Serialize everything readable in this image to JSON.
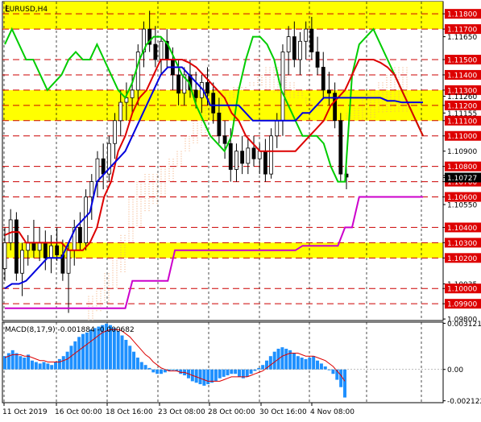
{
  "chart_data": [
    {
      "type": "candlestick",
      "title": "EURUSD,H4",
      "y_range": [
        1.0979,
        1.1188
      ],
      "y_ticks": [
        {
          "v": 1.118,
          "t": "1.11800",
          "style": "box-red"
        },
        {
          "v": 1.117,
          "t": "1.11700",
          "style": "box-red"
        },
        {
          "v": 1.1165,
          "t": "1.11650",
          "style": "plain"
        },
        {
          "v": 1.115,
          "t": "1.11500",
          "style": "box-red"
        },
        {
          "v": 1.114,
          "t": "1.11400",
          "style": "box-red"
        },
        {
          "v": 1.113,
          "t": "1.11300",
          "style": "box-red"
        },
        {
          "v": 1.1126,
          "t": "1.11260",
          "style": "plain"
        },
        {
          "v": 1.112,
          "t": "1.11200",
          "style": "box-red"
        },
        {
          "v": 1.1115,
          "t": "1.11155",
          "style": "plain"
        },
        {
          "v": 1.111,
          "t": "1.11100",
          "style": "box-red"
        },
        {
          "v": 1.11,
          "t": "1.11000",
          "style": "box-red"
        },
        {
          "v": 1.109,
          "t": "1.10900",
          "style": "plain"
        },
        {
          "v": 1.108,
          "t": "1.10800",
          "style": "box-red"
        },
        {
          "v": 1.1074,
          "t": "1.10745",
          "style": "plain"
        },
        {
          "v": 1.107,
          "t": "1.10700",
          "style": "box-red"
        },
        {
          "v": 1.106,
          "t": "1.10600",
          "style": "box-red"
        },
        {
          "v": 1.1055,
          "t": "1.10550",
          "style": "plain"
        },
        {
          "v": 1.104,
          "t": "1.10400",
          "style": "box-red"
        },
        {
          "v": 1.103,
          "t": "1.10300",
          "style": "box-red"
        },
        {
          "v": 1.102,
          "t": "1.10200",
          "style": "box-red"
        },
        {
          "v": 1.1003,
          "t": "1.10035",
          "style": "plain"
        },
        {
          "v": 1.1,
          "t": "1.10000",
          "style": "box-red"
        },
        {
          "v": 1.099,
          "t": "1.09900",
          "style": "box-red"
        },
        {
          "v": 1.098,
          "t": "1.09800",
          "style": "plain"
        },
        {
          "v": 1.10727,
          "t": "1.10727",
          "style": "box-dark"
        }
      ],
      "red_levels": [
        1.118,
        1.117,
        1.115,
        1.114,
        1.113,
        1.112,
        1.111,
        1.11,
        1.108,
        1.107,
        1.106,
        1.104,
        1.103,
        1.102,
        1.1,
        1.099
      ],
      "yellow_bands": [
        [
          1.117,
          1.1188
        ],
        [
          1.111,
          1.113
        ],
        [
          1.102,
          1.103
        ]
      ],
      "x_labels": [
        "11 Oct 2019",
        "16 Oct 00:00",
        "18 Oct 16:00",
        "23 Oct 08:00",
        "28 Oct 00:00",
        "30 Oct 16:00",
        "4 Nov 08:00"
      ],
      "candles": [
        [
          1.1013,
          1.104,
          1.1005,
          1.103
        ],
        [
          1.103,
          1.1052,
          1.1025,
          1.1045
        ],
        [
          1.1045,
          1.105,
          1.1005,
          1.101
        ],
        [
          1.101,
          1.103,
          1.0995,
          1.1025
        ],
        [
          1.1025,
          1.1035,
          1.1015,
          1.103
        ],
        [
          1.103,
          1.1045,
          1.102,
          1.1025
        ],
        [
          1.1025,
          1.104,
          1.1018,
          1.103
        ],
        [
          1.103,
          1.1038,
          1.1012,
          1.102
        ],
        [
          1.102,
          1.1035,
          1.101,
          1.1028
        ],
        [
          1.1028,
          1.104,
          1.1018,
          1.1022
        ],
        [
          1.1022,
          1.1032,
          1.1005,
          1.101
        ],
        [
          1.101,
          1.103,
          1.0984,
          1.1025
        ],
        [
          1.1025,
          1.1045,
          1.1015,
          1.104
        ],
        [
          1.104,
          1.105,
          1.1025,
          1.103
        ],
        [
          1.103,
          1.1065,
          1.1025,
          1.106
        ],
        [
          1.106,
          1.1075,
          1.1045,
          1.107
        ],
        [
          1.107,
          1.109,
          1.106,
          1.1085
        ],
        [
          1.1085,
          1.1095,
          1.1065,
          1.1075
        ],
        [
          1.1075,
          1.11,
          1.107,
          1.1095
        ],
        [
          1.1095,
          1.1115,
          1.1085,
          1.111
        ],
        [
          1.111,
          1.113,
          1.11,
          1.1122
        ],
        [
          1.1122,
          1.1135,
          1.111,
          1.1125
        ],
        [
          1.1125,
          1.114,
          1.1115,
          1.113
        ],
        [
          1.113,
          1.116,
          1.112,
          1.1155
        ],
        [
          1.1155,
          1.1175,
          1.1145,
          1.117
        ],
        [
          1.117,
          1.1182,
          1.1155,
          1.116
        ],
        [
          1.116,
          1.1172,
          1.1145,
          1.115
        ],
        [
          1.115,
          1.1165,
          1.114,
          1.1162
        ],
        [
          1.1162,
          1.117,
          1.1145,
          1.115
        ],
        [
          1.115,
          1.1158,
          1.113,
          1.114
        ],
        [
          1.114,
          1.115,
          1.112,
          1.1128
        ],
        [
          1.1128,
          1.1145,
          1.112,
          1.114
        ],
        [
          1.114,
          1.115,
          1.1125,
          1.113
        ],
        [
          1.113,
          1.1142,
          1.1118,
          1.1125
        ],
        [
          1.1125,
          1.114,
          1.1115,
          1.1135
        ],
        [
          1.1135,
          1.1145,
          1.112,
          1.1128
        ],
        [
          1.1128,
          1.1135,
          1.1108,
          1.1115
        ],
        [
          1.1115,
          1.1125,
          1.1095,
          1.11
        ],
        [
          1.11,
          1.111,
          1.1085,
          1.1095
        ],
        [
          1.1095,
          1.1105,
          1.107,
          1.1078
        ],
        [
          1.1078,
          1.1095,
          1.107,
          1.109
        ],
        [
          1.109,
          1.11,
          1.1075,
          1.1082
        ],
        [
          1.1082,
          1.1098,
          1.1075,
          1.1092
        ],
        [
          1.1092,
          1.11,
          1.108,
          1.1085
        ],
        [
          1.1085,
          1.1095,
          1.1075,
          1.109
        ],
        [
          1.109,
          1.1098,
          1.107,
          1.1075
        ],
        [
          1.1075,
          1.1105,
          1.1072,
          1.11
        ],
        [
          1.11,
          1.1115,
          1.1092,
          1.111
        ],
        [
          1.111,
          1.116,
          1.11,
          1.1155
        ],
        [
          1.1155,
          1.1172,
          1.114,
          1.1165
        ],
        [
          1.1165,
          1.1175,
          1.1145,
          1.115
        ],
        [
          1.115,
          1.1168,
          1.114,
          1.1162
        ],
        [
          1.1162,
          1.1175,
          1.115,
          1.117
        ],
        [
          1.117,
          1.1178,
          1.115,
          1.1155
        ],
        [
          1.1155,
          1.1165,
          1.114,
          1.1145
        ],
        [
          1.1145,
          1.1155,
          1.1125,
          1.113
        ],
        [
          1.113,
          1.1142,
          1.112,
          1.1128
        ],
        [
          1.1128,
          1.1135,
          1.1105,
          1.111
        ],
        [
          1.111,
          1.1115,
          1.107,
          1.1075
        ],
        [
          1.1075,
          1.1085,
          1.1065,
          1.1073
        ]
      ],
      "lines": [
        {
          "color": "#00cc00",
          "width": 2,
          "values": [
            1.116,
            1.117,
            1.116,
            1.115,
            1.115,
            1.114,
            1.113,
            1.1135,
            1.114,
            1.115,
            1.1155,
            1.115,
            1.115,
            1.116,
            1.115,
            1.114,
            1.113,
            1.1125,
            1.1135,
            1.115,
            1.116,
            1.1165,
            1.1165,
            1.116,
            1.115,
            1.114,
            1.1135,
            1.112,
            1.111,
            1.11,
            1.1095,
            1.109,
            1.11,
            1.113,
            1.115,
            1.1165,
            1.1165,
            1.116,
            1.115,
            1.113,
            1.112,
            1.111,
            1.11,
            1.11,
            1.11,
            1.1095,
            1.108,
            1.107,
            1.107,
            1.114,
            1.116,
            1.1165,
            1.117,
            1.116,
            1.115,
            1.114,
            1.113,
            1.112,
            1.111,
            1.11
          ]
        },
        {
          "color": "#dd0000",
          "width": 2,
          "values": [
            1.1035,
            1.1037,
            1.1037,
            1.103,
            1.103,
            1.103,
            1.103,
            1.103,
            1.103,
            1.1025,
            1.1025,
            1.1025,
            1.103,
            1.104,
            1.106,
            1.107,
            1.109,
            1.11,
            1.1115,
            1.1125,
            1.113,
            1.114,
            1.115,
            1.115,
            1.115,
            1.115,
            1.1148,
            1.1145,
            1.114,
            1.1135,
            1.113,
            1.1125,
            1.1115,
            1.111,
            1.11,
            1.1095,
            1.109,
            1.109,
            1.109,
            1.109,
            1.109,
            1.109,
            1.1095,
            1.11,
            1.1105,
            1.111,
            1.112,
            1.1125,
            1.113,
            1.114,
            1.115,
            1.115,
            1.115,
            1.1148,
            1.1145,
            1.114,
            1.113,
            1.112,
            1.111,
            1.11
          ]
        },
        {
          "color": "#0000dd",
          "width": 2,
          "values": [
            1.1,
            1.1003,
            1.1003,
            1.1005,
            1.101,
            1.1015,
            1.102,
            1.102,
            1.102,
            1.103,
            1.104,
            1.1045,
            1.105,
            1.107,
            1.1075,
            1.108,
            1.1085,
            1.109,
            1.11,
            1.111,
            1.112,
            1.113,
            1.114,
            1.1145,
            1.1145,
            1.1145,
            1.114,
            1.1135,
            1.113,
            1.112,
            1.112,
            1.112,
            1.112,
            1.112,
            1.1115,
            1.111,
            1.111,
            1.111,
            1.111,
            1.111,
            1.111,
            1.111,
            1.1115,
            1.1115,
            1.112,
            1.1125,
            1.1125,
            1.1125,
            1.1125,
            1.1125,
            1.1125,
            1.1125,
            1.1125,
            1.1125,
            1.1123,
            1.1123,
            1.1122,
            1.1122,
            1.1122,
            1.1122
          ]
        },
        {
          "color": "#cc00cc",
          "width": 2,
          "values": [
            1.0987,
            1.0987,
            1.0987,
            1.0987,
            1.0987,
            1.0987,
            1.0987,
            1.0987,
            1.0987,
            1.0987,
            1.0987,
            1.0987,
            1.0987,
            1.0987,
            1.0987,
            1.0987,
            1.0987,
            1.0987,
            1.1005,
            1.1005,
            1.1005,
            1.1005,
            1.1005,
            1.1005,
            1.1025,
            1.1025,
            1.1025,
            1.1025,
            1.1025,
            1.1025,
            1.1025,
            1.1025,
            1.1025,
            1.1025,
            1.1025,
            1.1025,
            1.1025,
            1.1025,
            1.1025,
            1.1025,
            1.1025,
            1.1025,
            1.1028,
            1.1028,
            1.1028,
            1.1028,
            1.1028,
            1.1028,
            1.104,
            1.104,
            1.106,
            1.106,
            1.106,
            1.106,
            1.106,
            1.106,
            1.106,
            1.106,
            1.106,
            1.106
          ]
        }
      ],
      "cloud": {
        "from": [
          1.0979,
          1.0985,
          1.099,
          1.1,
          1.101,
          1.103,
          1.104,
          1.105,
          1.1055,
          1.106,
          1.107,
          1.108,
          1.109,
          1.1095,
          1.11,
          1.111,
          1.1115,
          1.112,
          1.1125,
          1.113,
          1.1135,
          1.114,
          1.1145,
          1.1145,
          1.114,
          1.1135,
          1.113,
          1.1125,
          1.112,
          1.1115,
          1.111,
          1.111,
          1.1115,
          1.112,
          1.1125,
          1.113,
          1.1135,
          1.114,
          1.1145,
          1.1145
        ],
        "to": [
          1.0995,
          1.1,
          1.101,
          1.102,
          1.1035,
          1.106,
          1.107,
          1.1075,
          1.1075,
          1.108,
          1.1085,
          1.109,
          1.11,
          1.111,
          1.112,
          1.1125,
          1.1128,
          1.113,
          1.1132,
          1.1132,
          1.1132,
          1.1132,
          1.113,
          1.1128,
          1.1125,
          1.1125,
          1.1125,
          1.112,
          1.1118,
          1.1115,
          1.1112,
          1.111,
          1.111,
          1.111,
          1.111,
          1.1112,
          1.1115,
          1.1115,
          1.1115,
          1.1115
        ]
      }
    },
    {
      "type": "bar",
      "title": "MACD(8,17,9) -0.001884 -0.000682",
      "y_range": [
        -0.00225,
        0.0032
      ],
      "y_ticks": [
        {
          "v": 0.003121,
          "t": "0.003121"
        },
        {
          "v": 0.0,
          "t": "0.00"
        },
        {
          "v": -0.002122,
          "t": "-0.002122"
        }
      ],
      "histogram": [
        0.0009,
        0.0011,
        0.0013,
        0.0011,
        0.0009,
        0.0008,
        0.001,
        0.0006,
        0.0005,
        0.0004,
        0.0005,
        0.0004,
        0.0003,
        0.0005,
        0.0007,
        0.0009,
        0.0012,
        0.0016,
        0.0019,
        0.0022,
        0.0024,
        0.0025,
        0.0027,
        0.0028,
        0.0029,
        0.003,
        0.0031,
        0.003,
        0.0028,
        0.0026,
        0.0023,
        0.002,
        0.0016,
        0.0012,
        0.0008,
        0.0005,
        0.0003,
        0.0001,
        -0.0002,
        -0.0003,
        -0.0003,
        -0.0002,
        -0.0001,
        0.0,
        -0.0001,
        -0.0003,
        -0.0004,
        -0.0006,
        -0.0008,
        -0.0009,
        -0.001,
        -0.0011,
        -0.001,
        -0.0009,
        -0.0008,
        -0.0006,
        -0.0005,
        -0.0004,
        -0.0003,
        -0.0003,
        -0.0005,
        -0.0006,
        -0.0005,
        -0.0003,
        -0.0001,
        0.0001,
        0.0003,
        0.0006,
        0.0009,
        0.0012,
        0.0014,
        0.0015,
        0.0014,
        0.0013,
        0.0011,
        0.0009,
        0.0008,
        0.0007,
        0.0008,
        0.0009,
        0.0006,
        0.0004,
        0.0002,
        0.0,
        -0.0003,
        -0.0007,
        -0.0012,
        -0.0019
      ],
      "signal": [
        0.0008,
        0.0009,
        0.001,
        0.001,
        0.001,
        0.0009,
        0.0009,
        0.0008,
        0.0007,
        0.0006,
        0.0006,
        0.0005,
        0.0005,
        0.0005,
        0.0005,
        0.0006,
        0.0007,
        0.0009,
        0.0011,
        0.0013,
        0.0015,
        0.0017,
        0.0019,
        0.0021,
        0.0023,
        0.0025,
        0.0026,
        0.0027,
        0.0027,
        0.0027,
        0.0026,
        0.0024,
        0.0022,
        0.0019,
        0.0016,
        0.0013,
        0.001,
        0.0008,
        0.0005,
        0.0003,
        0.0001,
        0.0,
        -0.0001,
        -0.0001,
        -0.0001,
        -0.0002,
        -0.0002,
        -0.0003,
        -0.0004,
        -0.0005,
        -0.0006,
        -0.0007,
        -0.0008,
        -0.0008,
        -0.0008,
        -0.0008,
        -0.0007,
        -0.0006,
        -0.0005,
        -0.0005,
        -0.0005,
        -0.0005,
        -0.0005,
        -0.0004,
        -0.0003,
        -0.0002,
        -0.0001,
        0.0001,
        0.0003,
        0.0005,
        0.0007,
        0.0009,
        0.001,
        0.0011,
        0.0011,
        0.0011,
        0.001,
        0.0009,
        0.0009,
        0.0009,
        0.0008,
        0.0007,
        0.0006,
        0.0004,
        0.0002,
        -0.0001,
        -0.0004,
        -0.0008
      ]
    }
  ]
}
